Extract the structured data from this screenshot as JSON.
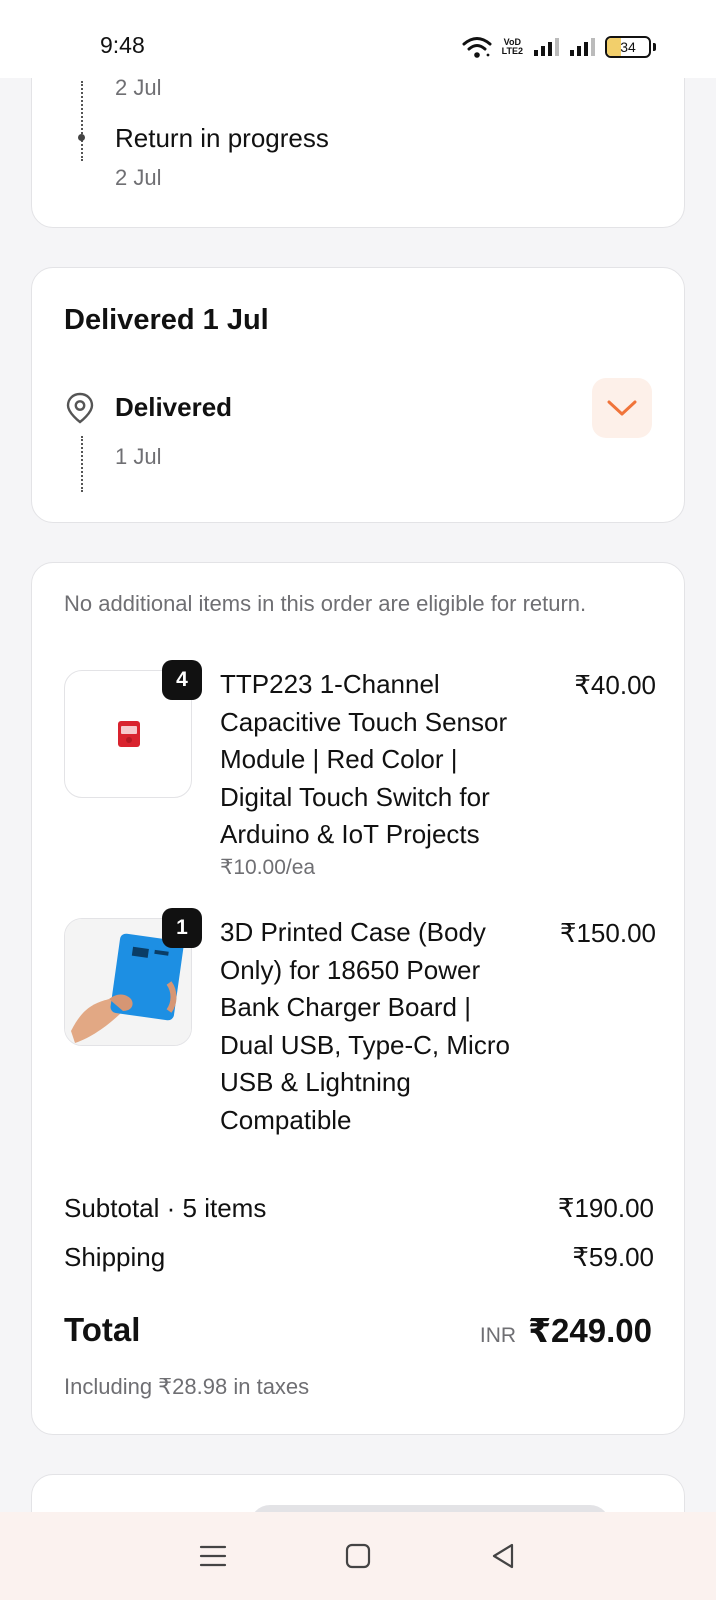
{
  "status_bar": {
    "time": "9:48",
    "battery": "34",
    "battery_level": 0.34,
    "volte_top": "VoD",
    "volte_bottom": "LTE2"
  },
  "timeline_top": {
    "prev_date": "2 Jul",
    "step_title": "Return in progress",
    "step_date": "2 Jul"
  },
  "delivered_card": {
    "heading": "Delivered 1 Jul",
    "status": "Delivered",
    "date": "1 Jul",
    "accent_color": "#f0743a"
  },
  "order": {
    "notice": "No additional items in this order are eligible for return.",
    "items": [
      {
        "quantity": "4",
        "name": "TTP223 1-Channel Capacitive Touch Sensor Module | Red Color | Digital Touch Switch for Arduino & IoT Projects",
        "price": "₹40.00",
        "unit_price": "₹10.00/ea"
      },
      {
        "quantity": "1",
        "name": "3D Printed Case (Body Only) for 18650 Power Bank Charger Board | Dual USB, Type-C, Micro USB & Lightning Compatible",
        "price": "₹150.00"
      }
    ],
    "subtotal_label": "Subtotal · 5 items",
    "subtotal_value": "₹190.00",
    "shipping_label": "Shipping",
    "shipping_value": "₹59.00",
    "total_label": "Total",
    "currency": "INR",
    "total_value": "₹249.00",
    "tax_note": "Including ₹28.98 in taxes"
  },
  "icons": {
    "wifi": "wifi-icon",
    "signal": "signal-icon",
    "location": "location-pin-icon",
    "chevron": "chevron-down-icon",
    "menu": "menu-icon",
    "home": "home-square-icon",
    "back": "back-triangle-icon"
  }
}
